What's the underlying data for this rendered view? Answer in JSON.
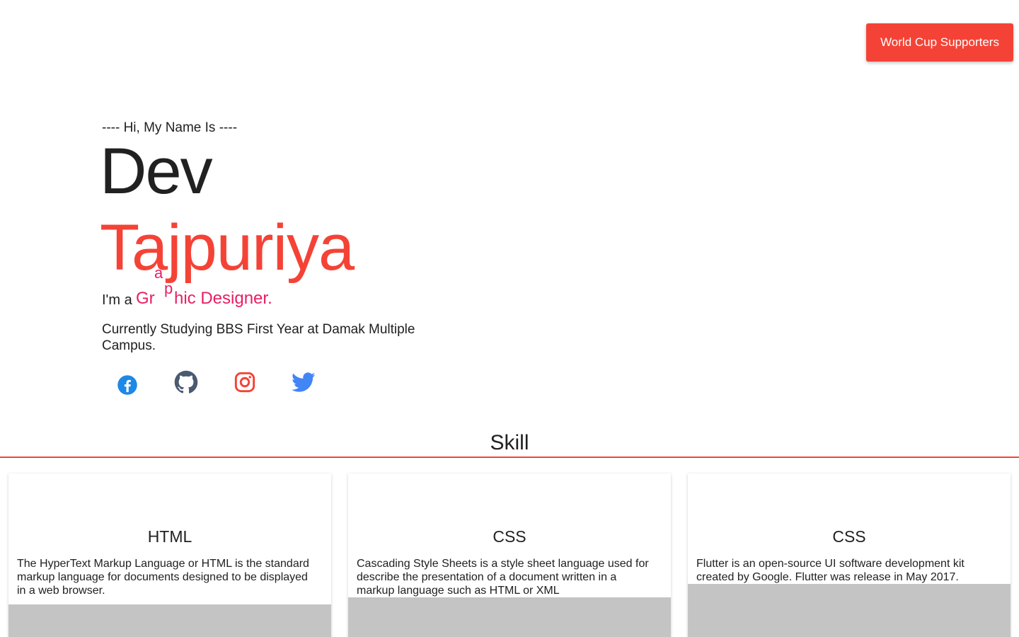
{
  "header": {
    "cta_label": "World Cup Supporters"
  },
  "hero": {
    "intro": "---- Hi, My Name Is ----",
    "first_name": "Dev",
    "last_name": "Tajpuriya",
    "role_prefix": "I'm a",
    "role_parts": [
      "Gr",
      "a",
      "p",
      "hic Designer."
    ],
    "study": "Currently Studying BBS First Year at Damak Multiple Campus."
  },
  "social": {
    "icons": [
      "facebook-icon",
      "github-icon",
      "instagram-icon",
      "twitter-icon"
    ]
  },
  "skills": {
    "title": "Skill",
    "cards": [
      {
        "title": "HTML",
        "description": "The HyperText Markup Language or HTML is the standard markup language for documents designed to be displayed in a web browser."
      },
      {
        "title": "CSS",
        "description": "Cascading Style Sheets is a style sheet language used for describe the presentation of a document written in a markup language such as HTML or XML"
      },
      {
        "title": "CSS",
        "description": "Flutter is an open-source UI software development kit created by Google. Flutter was release in May 2017."
      }
    ]
  },
  "colors": {
    "accent": "#f44336",
    "role_text": "#e91e63",
    "facebook": "#1e88e5",
    "github": "#4a5a70",
    "instagram": "#f44336",
    "twitter": "#4285f4",
    "card_image_placeholder": "#c4c4c4"
  }
}
